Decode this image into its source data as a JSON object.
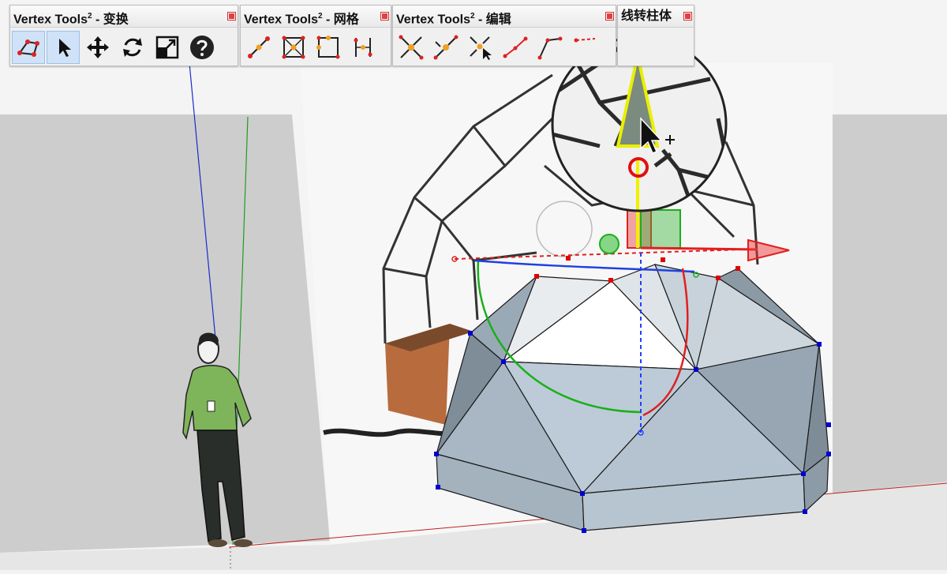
{
  "toolbars": [
    {
      "title_main": "Vertex Tools",
      "title_sup": "2",
      "title_sub": " - 变换",
      "buttons": [
        {
          "name": "select-vertices-button",
          "icon": "vertex-select-icon",
          "active": true
        },
        {
          "name": "pointer-button",
          "icon": "arrow-cursor-icon",
          "active": true
        },
        {
          "name": "move-button",
          "icon": "move-arrows-icon",
          "active": false
        },
        {
          "name": "rotate-button",
          "icon": "rotate-icon",
          "active": false
        },
        {
          "name": "scale-button",
          "icon": "scale-icon",
          "active": false
        },
        {
          "name": "help-button",
          "icon": "help-icon",
          "active": false
        }
      ]
    },
    {
      "title_main": "Vertex Tools",
      "title_sup": "2",
      "title_sub": " - 网格",
      "buttons": [
        {
          "name": "line-mesh-button",
          "icon": "line-icon",
          "active": false
        },
        {
          "name": "quad-mesh-button",
          "icon": "quad-cross-icon",
          "active": false
        },
        {
          "name": "border-mesh-button",
          "icon": "border-icon",
          "active": false
        },
        {
          "name": "grid-mesh-button",
          "icon": "grid-lines-icon",
          "active": false
        }
      ]
    },
    {
      "title_main": "Vertex Tools",
      "title_sup": "2",
      "title_sub": " - 编辑",
      "buttons": [
        {
          "name": "merge-button",
          "icon": "merge-icon",
          "active": false
        },
        {
          "name": "merge-to-button",
          "icon": "merge-to-icon",
          "active": false
        },
        {
          "name": "merge-cursor-button",
          "icon": "merge-cursor-icon",
          "active": false
        },
        {
          "name": "connect-button",
          "icon": "connect-icon",
          "active": false
        },
        {
          "name": "corner-button",
          "icon": "corner-icon",
          "active": false
        },
        {
          "name": "extra-edit-button",
          "icon": "edit-icon",
          "active": false
        }
      ]
    },
    {
      "title_main": "线转柱体",
      "title_sup": "",
      "title_sub": "",
      "buttons": []
    }
  ],
  "colors": {
    "background": "#f3f3f3",
    "wall": "#cdcdcd",
    "ground": "#e4e4e4",
    "mesh_face": "#bccbd7",
    "mesh_face_dark": "#8fa0ad",
    "vertex_selected": "#e00000",
    "vertex": "#0000d0",
    "axis_red": "#e02020",
    "axis_green": "#20a020",
    "axis_blue": "#2040ff",
    "gizmo_yellow": "#f0f000",
    "wood": "#b8693a"
  }
}
